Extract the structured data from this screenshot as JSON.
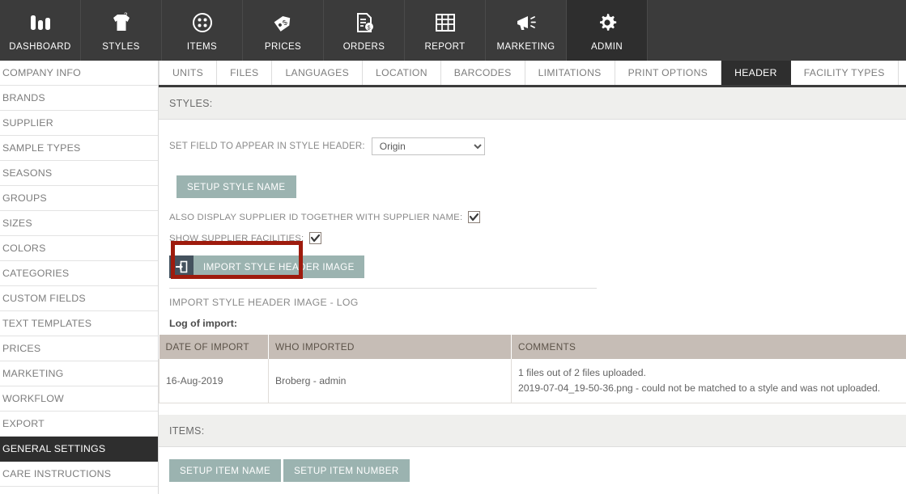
{
  "topnav": {
    "items": [
      {
        "label": "DASHBOARD",
        "icon": "bar-chart-icon",
        "active": false
      },
      {
        "label": "STYLES",
        "icon": "tshirt-icon",
        "active": false
      },
      {
        "label": "ITEMS",
        "icon": "button-icon",
        "active": false
      },
      {
        "label": "PRICES",
        "icon": "price-tag-icon",
        "active": false
      },
      {
        "label": "ORDERS",
        "icon": "invoice-icon",
        "active": false
      },
      {
        "label": "REPORT",
        "icon": "grid-icon",
        "active": false
      },
      {
        "label": "MARKETING",
        "icon": "megaphone-icon",
        "active": false
      },
      {
        "label": "ADMIN",
        "icon": "gear-icon",
        "active": true
      }
    ]
  },
  "sidebar": {
    "items": [
      {
        "label": "COMPANY INFO",
        "active": false
      },
      {
        "label": "BRANDS",
        "active": false
      },
      {
        "label": "SUPPLIER",
        "active": false
      },
      {
        "label": "SAMPLE TYPES",
        "active": false
      },
      {
        "label": "SEASONS",
        "active": false
      },
      {
        "label": "GROUPS",
        "active": false
      },
      {
        "label": "SIZES",
        "active": false
      },
      {
        "label": "COLORS",
        "active": false
      },
      {
        "label": "CATEGORIES",
        "active": false
      },
      {
        "label": "CUSTOM FIELDS",
        "active": false
      },
      {
        "label": "TEXT TEMPLATES",
        "active": false
      },
      {
        "label": "PRICES",
        "active": false
      },
      {
        "label": "MARKETING",
        "active": false
      },
      {
        "label": "WORKFLOW",
        "active": false
      },
      {
        "label": "EXPORT",
        "active": false
      },
      {
        "label": "GENERAL SETTINGS",
        "active": true
      },
      {
        "label": "CARE INSTRUCTIONS",
        "active": false
      }
    ]
  },
  "subtabs": {
    "items": [
      {
        "label": "UNITS",
        "active": false
      },
      {
        "label": "FILES",
        "active": false
      },
      {
        "label": "LANGUAGES",
        "active": false
      },
      {
        "label": "LOCATION",
        "active": false
      },
      {
        "label": "BARCODES",
        "active": false
      },
      {
        "label": "LIMITATIONS",
        "active": false
      },
      {
        "label": "PRINT OPTIONS",
        "active": false
      },
      {
        "label": "HEADER",
        "active": true
      },
      {
        "label": "FACILITY TYPES",
        "active": false
      }
    ]
  },
  "styles_section": {
    "heading": "STYLES:",
    "field_label": "SET FIELD TO APPEAR IN STYLE HEADER:",
    "select_value": "Origin",
    "select_options": [
      "Origin"
    ],
    "setup_style_name_button": "SETUP STYLE NAME",
    "supplier_id_label": "ALSO DISPLAY SUPPLIER ID TOGETHER WITH SUPPLIER NAME:",
    "supplier_id_checked": true,
    "show_facilities_label": "SHOW SUPPLIER FACILITIES:",
    "show_facilities_checked": true,
    "import_button": "IMPORT STYLE HEADER IMAGE",
    "import_icon": "import-arrow-icon",
    "log_heading": "IMPORT STYLE HEADER IMAGE - LOG",
    "log_subheading": "Log of import:"
  },
  "log_table": {
    "columns": [
      "DATE OF IMPORT",
      "WHO IMPORTED",
      "COMMENTS"
    ],
    "rows": [
      {
        "date": "16-Aug-2019",
        "who": "Broberg - admin",
        "comment_line1": "1 files out of 2 files uploaded.",
        "comment_line2": "2019-07-04_19-50-36.png - could not be matched to a style and was not uploaded."
      }
    ]
  },
  "items_section": {
    "heading": "ITEMS:",
    "setup_item_name_button": "SETUP ITEM NAME",
    "setup_item_number_button": "SETUP ITEM NUMBER"
  },
  "colors": {
    "nav_bg": "#3b3b3b",
    "nav_active": "#2e2e2e",
    "teal_button": "#9bb3b0",
    "icon_block": "#44525e",
    "table_header": "#c6bdb6",
    "highlight_box": "#9e1b0d",
    "section_bar": "#efefed"
  }
}
